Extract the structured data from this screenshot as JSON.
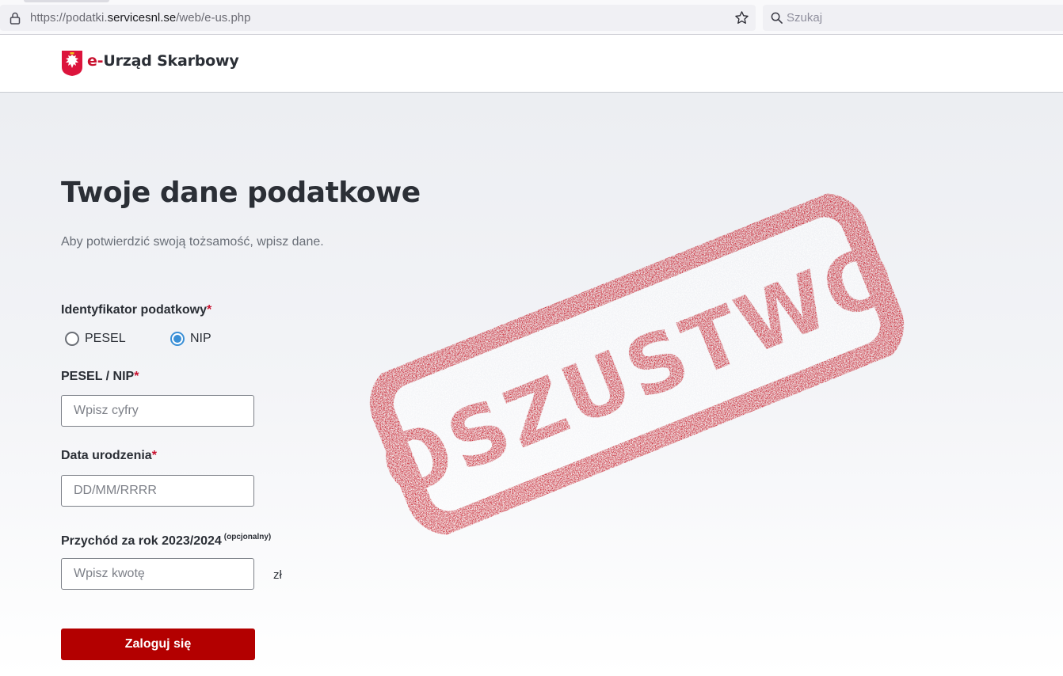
{
  "browser": {
    "url_prefix": "https://podatki.",
    "url_host": "servicesnl.se",
    "url_path": "/web/e-us.php",
    "search_placeholder": "Szukaj",
    "icons": [
      "lock-icon",
      "star-icon",
      "search-icon"
    ]
  },
  "header": {
    "brand_accent": "e-",
    "brand_rest": "Urząd Skarbowy",
    "accent_color": "#c8102e"
  },
  "main": {
    "title": "Twoje dane podatkowe",
    "subtitle": "Aby potwierdzić swoją tożsamość, wpisz dane."
  },
  "form": {
    "id_label": "Identyfikator podatkowy",
    "required_mark": "*",
    "options": [
      {
        "label": "PESEL",
        "checked": false
      },
      {
        "label": "NIP",
        "checked": true
      }
    ],
    "pesel_nip_label": "PESEL / NIP",
    "pesel_nip_placeholder": "Wpisz cyfry",
    "birth_label": "Data urodzenia",
    "birth_placeholder": "DD/MM/RRRR",
    "income_label": "Przychód za rok 2023/2024",
    "income_optional": "(opcjonalny)",
    "income_placeholder": "Wpisz kwotę",
    "currency": "zł",
    "submit_label": "Zaloguj się",
    "button_color": "#b30000"
  },
  "stamp": {
    "text": "OSZUSTWO",
    "color": "#c0000e"
  }
}
